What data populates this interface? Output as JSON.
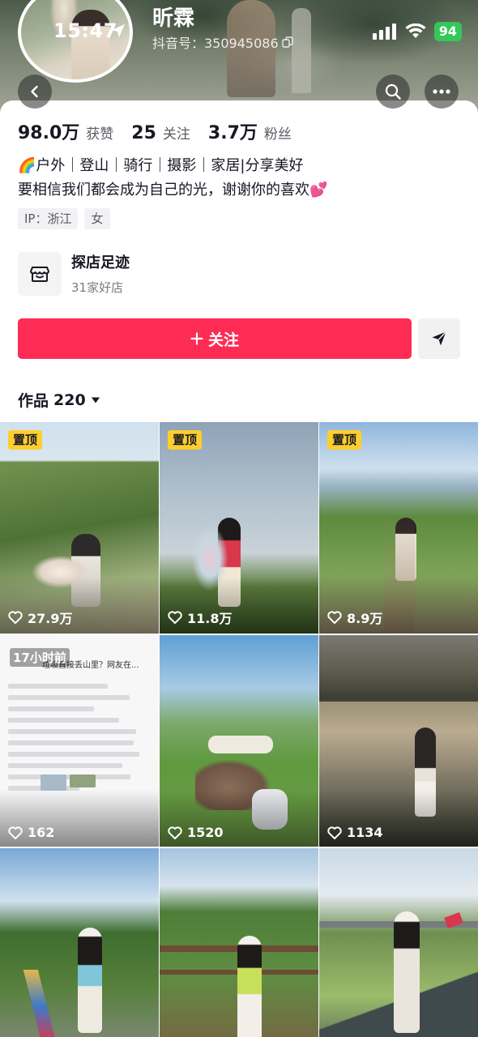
{
  "status_bar": {
    "time": "15:47",
    "battery": "94"
  },
  "profile": {
    "nickname": "昕霖",
    "douyin_id": "抖音号：350945086"
  },
  "stats": [
    {
      "value": "98.0万",
      "label": "获赞"
    },
    {
      "value": "25",
      "label": "关注"
    },
    {
      "value": "3.7万",
      "label": "粉丝"
    }
  ],
  "bio": {
    "line1": "🌈户外｜登山｜骑行｜摄影｜家居|分享美好",
    "line2": "要相信我们都会成为自己的光，谢谢你的喜欢💕"
  },
  "tags": [
    "IP：浙江",
    "女"
  ],
  "shop": {
    "title": "探店足迹",
    "subtitle": "31家好店"
  },
  "actions": {
    "follow_label": "关注"
  },
  "works": {
    "label": "作品",
    "count": "220"
  },
  "grid": [
    {
      "pinned": "置顶",
      "likes": "27.9万"
    },
    {
      "pinned": "置顶",
      "likes": "11.8万"
    },
    {
      "pinned": "置顶",
      "likes": "8.9万"
    },
    {
      "time": "17小时前",
      "likes": "162",
      "doc_title": "垃圾直接丢山里？网友在..."
    },
    {
      "likes": "1520"
    },
    {
      "likes": "1134"
    },
    {
      "likes": ""
    },
    {
      "likes": ""
    },
    {
      "likes": ""
    }
  ],
  "colors": {
    "accent": "#fe2c55",
    "pin": "#fece2f",
    "battery": "#34c759"
  }
}
